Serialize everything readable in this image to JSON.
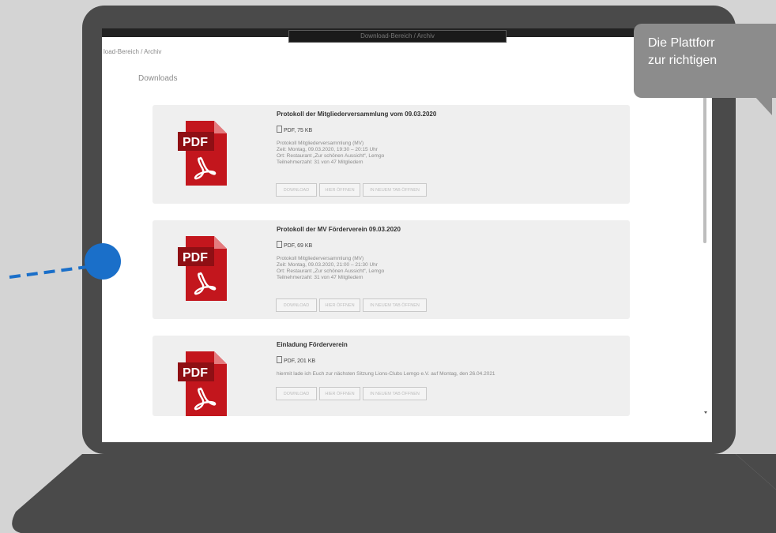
{
  "browser": {
    "title": "Download-Bereich / Archiv"
  },
  "breadcrumb": "load-Bereich / Archiv",
  "section_title": "Downloads",
  "tooltip": {
    "line1": "Die Plattforr",
    "line2": "zur richtigen"
  },
  "icon": {
    "pdf_label": "PDF"
  },
  "colors": {
    "accent": "#1a6fc9",
    "pdf_red": "#c3161d",
    "tooltip": "#8c8c8c"
  },
  "downloads": [
    {
      "title": "Protokoll der Mitgliederversammlung vom 09.03.2020",
      "meta": "PDF, 75 KB",
      "desc": [
        "Protokoll Mitgliederversammlung (MV)",
        "Zeit: Montag, 09.03.2020, 19:30 – 20:15 Uhr",
        "Ort: Restaurant „Zur schönen Aussicht“, Lemgo",
        "Teilnehmerzahl: 31 von 47 Mitgliedern"
      ],
      "buttons": [
        "DOWNLOAD",
        "HIER ÖFFNEN",
        "IN NEUEM TAB ÖFFNEN"
      ]
    },
    {
      "title": "Protokoll der MV Förderverein 09.03.2020",
      "meta": "PDF, 69 KB",
      "desc": [
        "Protokoll Mitgliederversammlung (MV)",
        "Zeit: Montag, 09.03.2020, 21:00 – 21:30 Uhr",
        "Ort: Restaurant „Zur schönen Aussicht“, Lemgo",
        "Teilnehmerzahl: 31 von 47 Mitgliedern"
      ],
      "buttons": [
        "DOWNLOAD",
        "HIER ÖFFNEN",
        "IN NEUEM TAB ÖFFNEN"
      ]
    },
    {
      "title": "Einladung Förderverein",
      "meta": "PDF, 201 KB",
      "desc": [
        "hiermit lade ich Euch zur nächsten Sitzung Lions-Clubs Lemgo e.V. auf Montag, den 26.04.2021"
      ],
      "buttons": [
        "DOWNLOAD",
        "HIER ÖFFNEN",
        "IN NEUEM TAB ÖFFNEN"
      ]
    }
  ]
}
